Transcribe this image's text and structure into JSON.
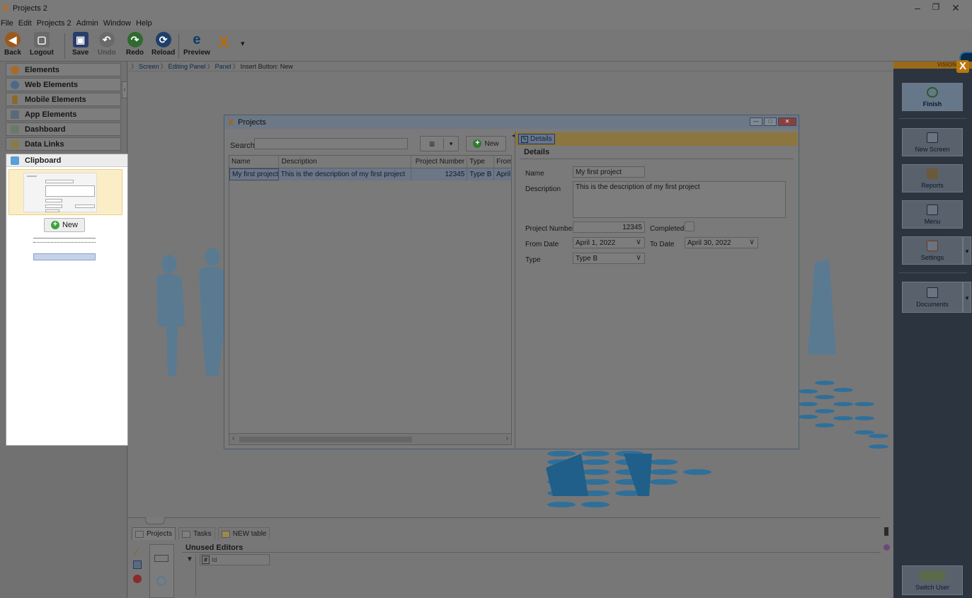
{
  "window": {
    "title": "Projects 2",
    "minimize": "–",
    "restore": "❐",
    "close": "✕"
  },
  "menu": [
    "File",
    "Edit",
    "Projects 2",
    "Admin",
    "Window",
    "Help"
  ],
  "toolbar": {
    "back": "Back",
    "logout": "Logout",
    "save": "Save",
    "undo": "Undo",
    "redo": "Redo",
    "reload": "Reload",
    "preview": "Preview",
    "dropdown": "▾"
  },
  "palette": {
    "categories": [
      "Elements",
      "Web Elements",
      "Mobile Elements",
      "App Elements",
      "Dashboard",
      "Data Links"
    ],
    "clipboard": "Clipboard",
    "clip_new": "New",
    "collapse": "‹"
  },
  "breadcrumb": {
    "items": [
      "Screen",
      "Editing Panel",
      "Panel"
    ],
    "current": "Insert Button: New"
  },
  "projects_window": {
    "title": "Projects",
    "search_label": "Search",
    "search_value": "",
    "menu_icon": "≡",
    "menu_arrow": "▾",
    "new_label": "New",
    "columns": [
      "Name",
      "Description",
      "Project Number",
      "Type",
      "From"
    ],
    "rows": [
      {
        "name": "My first project",
        "description": "This is the description of my first project",
        "number": "12345",
        "type": "Type B",
        "from": "April"
      }
    ],
    "details": {
      "chip": "Details",
      "heading": "Details",
      "name_label": "Name",
      "name_value": "My first project",
      "desc_label": "Description",
      "desc_value": "This is the description of my first project",
      "number_label": "Project Number",
      "number_value": "12345",
      "completed_label": "Completed",
      "from_label": "From Date",
      "from_value": "April 1, 2022",
      "to_label": "To Date",
      "to_value": "April 30, 2022",
      "type_label": "Type",
      "type_value": "Type B"
    }
  },
  "bottom": {
    "tabs": [
      "Projects",
      "Tasks",
      "NEW table"
    ],
    "unused_editors": "Unused Editors",
    "id_field": "Id",
    "hash": "#"
  },
  "vision": {
    "label": "VISION",
    "finish": "Finish",
    "new_screen": "New Screen",
    "reports": "Reports",
    "menu": "Menu",
    "settings": "Settings",
    "documents": "Documents",
    "switch_user": "Switch User",
    "arrow": "▾"
  }
}
